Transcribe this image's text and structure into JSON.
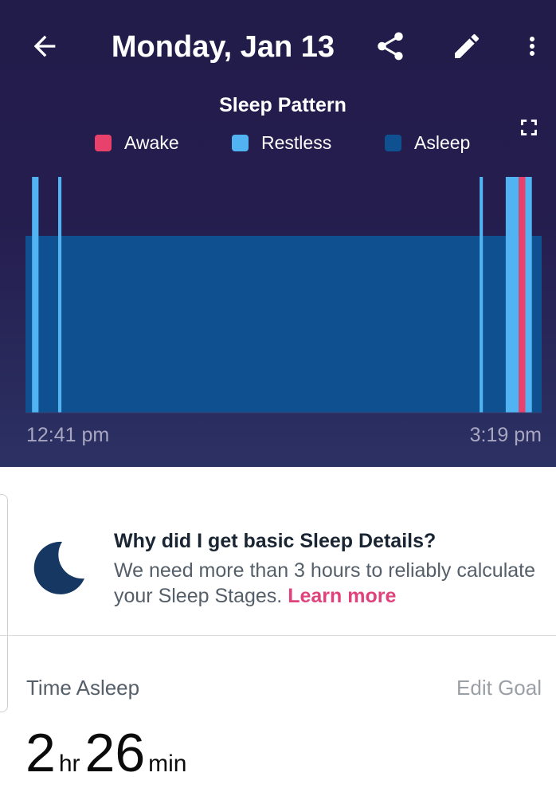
{
  "header": {
    "title": "Monday, Jan 13",
    "icons": [
      "arrow-back-icon",
      "share-icon",
      "pencil-icon",
      "more-vertical-icon"
    ]
  },
  "colors": {
    "background_top": "#221c4a",
    "background_bottom": "#2c3163",
    "awake": "#e8426c",
    "restless": "#52b3f2",
    "asleep": "#0e5090",
    "link": "#e0437c",
    "moon": "#153761"
  },
  "chart": {
    "title": "Sleep Pattern",
    "legend": [
      {
        "label": "Awake",
        "color": "#e8426c"
      },
      {
        "label": "Restless",
        "color": "#52b3f2"
      },
      {
        "label": "Asleep",
        "color": "#0e5090"
      }
    ],
    "start_label": "12:41 pm",
    "end_label": "3:19 pm"
  },
  "chart_data": {
    "type": "bar",
    "title": "Sleep Pattern",
    "x_start": "12:41 pm",
    "x_end": "3:19 pm",
    "duration_minutes": 158,
    "levels": [
      "Asleep",
      "Restless",
      "Awake"
    ],
    "segments": [
      {
        "state": "Asleep",
        "start": 0,
        "end": 158
      },
      {
        "state": "Restless",
        "start": 2,
        "end": 4
      },
      {
        "state": "Restless",
        "start": 10,
        "end": 11
      },
      {
        "state": "Restless",
        "start": 139,
        "end": 140
      },
      {
        "state": "Restless",
        "start": 147,
        "end": 151
      },
      {
        "state": "Awake",
        "start": 151,
        "end": 153
      },
      {
        "state": "Restless",
        "start": 153,
        "end": 155
      }
    ],
    "legend": [
      "Awake",
      "Restless",
      "Asleep"
    ],
    "grid": false
  },
  "info": {
    "title": "Why did I get basic Sleep Details?",
    "body": "We need more than 3 hours to reliably calculate your Sleep Stages.",
    "link": "Learn more"
  },
  "stats": {
    "label": "Time Asleep",
    "edit_goal": "Edit Goal",
    "hours": "2",
    "hours_unit": "hr",
    "minutes": "26",
    "minutes_unit": "min"
  }
}
